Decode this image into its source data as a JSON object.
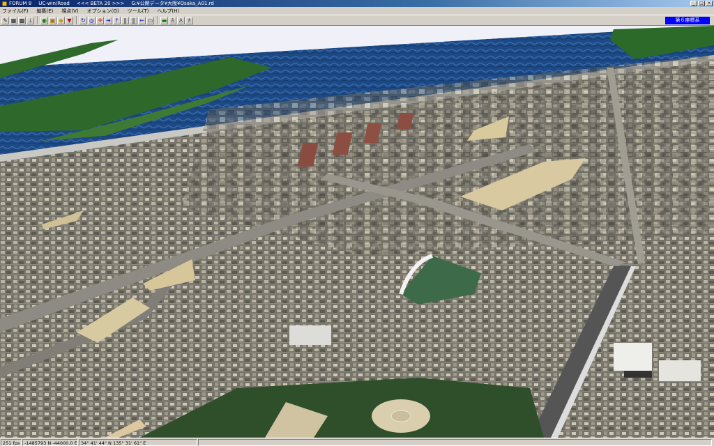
{
  "window": {
    "app_name": "FORUM 8",
    "product": "UC-win/Road",
    "version": "<<< BETA 20 >>>",
    "file_path": "G:¥公開データ¥大阪¥Osaka_A01.rd"
  },
  "menu": [
    "ファイル(F)",
    "編集(E)",
    "視点(V)",
    "オプション(O)",
    "ツール(T)",
    "ヘルプ(H)"
  ],
  "toolbar": {
    "groups": [
      [
        "pen-icon",
        "grid-icon",
        "grid2-icon",
        "chart-icon"
      ],
      [
        "road-icon",
        "lock-icon",
        "shield-icon",
        "filter-icon"
      ],
      [
        "rotate-icon",
        "globe-icon",
        "move-icon",
        "arrow-right-icon",
        "arrow-up-icon",
        "pause-icon",
        "pause2-icon",
        "arrow-left-icon",
        "box-icon"
      ],
      [
        "monitor-icon",
        "person-icon",
        "person2-icon",
        "walk-icon"
      ]
    ],
    "coordinate_system_label": "第６座標系"
  },
  "status": {
    "fps": "251 fps",
    "position": "-1485793 N -44000.0 E",
    "geo": "34° 41' 44\" N 135° 31' 61\" E"
  },
  "colors": {
    "water": "#1f4f8a",
    "land": "#2f6a2a",
    "city": "#7c786a",
    "accent": "#0000ff"
  }
}
